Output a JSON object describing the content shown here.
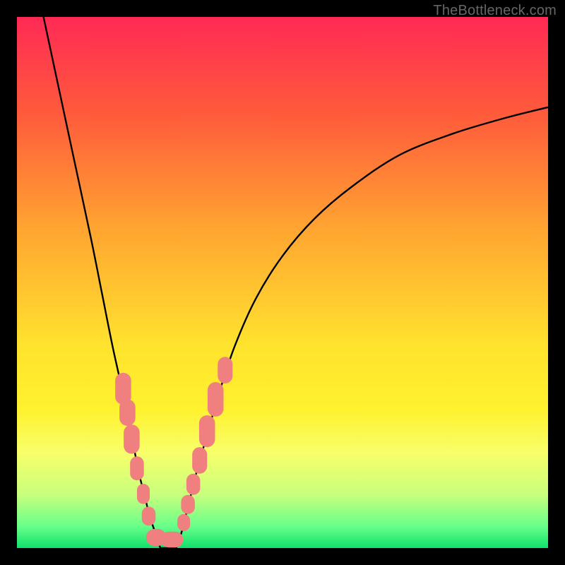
{
  "watermark": "TheBottleneck.com",
  "chart_data": {
    "type": "line",
    "title": "",
    "xlabel": "",
    "ylabel": "",
    "xlim": [
      0,
      100
    ],
    "ylim": [
      0,
      100
    ],
    "legend": null,
    "annotations": [],
    "background_gradient": {
      "stops": [
        {
          "offset": 0.0,
          "color": "#ff2a55"
        },
        {
          "offset": 0.18,
          "color": "#ff5a3c"
        },
        {
          "offset": 0.4,
          "color": "#ffa531"
        },
        {
          "offset": 0.62,
          "color": "#ffe32e"
        },
        {
          "offset": 0.74,
          "color": "#fff22f"
        },
        {
          "offset": 0.82,
          "color": "#f8ff6a"
        },
        {
          "offset": 0.9,
          "color": "#c8ff7d"
        },
        {
          "offset": 0.96,
          "color": "#66ff8a"
        },
        {
          "offset": 1.0,
          "color": "#10e06a"
        }
      ]
    },
    "series": [
      {
        "name": "left-curve",
        "stroke": "#000000",
        "x": [
          5,
          8,
          11,
          14,
          16,
          18,
          20,
          21,
          22,
          23,
          24,
          25,
          26,
          27
        ],
        "y": [
          100,
          86,
          72,
          58,
          48,
          38,
          29,
          24,
          19,
          14,
          10,
          6,
          3,
          0
        ]
      },
      {
        "name": "right-curve",
        "stroke": "#000000",
        "x": [
          30,
          31,
          32,
          33,
          34,
          36,
          38,
          41,
          45,
          50,
          56,
          63,
          72,
          82,
          92,
          100
        ],
        "y": [
          0,
          3,
          7,
          11,
          15,
          22,
          29,
          38,
          47,
          55,
          62,
          68,
          74,
          78,
          81,
          83
        ]
      },
      {
        "name": "floor",
        "stroke": "#000000",
        "x": [
          27,
          30
        ],
        "y": [
          0,
          0
        ]
      }
    ],
    "markers": {
      "color": "#f08080",
      "points": [
        {
          "x": 20.0,
          "y": 30.0,
          "w": 3.0,
          "h": 6.0
        },
        {
          "x": 20.8,
          "y": 25.5,
          "w": 3.0,
          "h": 5.0
        },
        {
          "x": 21.6,
          "y": 20.5,
          "w": 3.0,
          "h": 5.5
        },
        {
          "x": 22.6,
          "y": 15.0,
          "w": 2.6,
          "h": 4.5
        },
        {
          "x": 23.8,
          "y": 10.2,
          "w": 2.4,
          "h": 3.8
        },
        {
          "x": 24.8,
          "y": 6.0,
          "w": 2.6,
          "h": 3.6
        },
        {
          "x": 26.2,
          "y": 2.0,
          "w": 3.8,
          "h": 3.2
        },
        {
          "x": 29.2,
          "y": 1.6,
          "w": 4.2,
          "h": 3.0
        },
        {
          "x": 31.4,
          "y": 4.8,
          "w": 2.4,
          "h": 3.2
        },
        {
          "x": 32.2,
          "y": 8.2,
          "w": 2.6,
          "h": 3.6
        },
        {
          "x": 33.2,
          "y": 12.0,
          "w": 2.6,
          "h": 4.0
        },
        {
          "x": 34.4,
          "y": 16.5,
          "w": 2.8,
          "h": 5.0
        },
        {
          "x": 35.8,
          "y": 22.0,
          "w": 3.0,
          "h": 6.0
        },
        {
          "x": 37.4,
          "y": 28.0,
          "w": 3.0,
          "h": 6.5
        },
        {
          "x": 39.2,
          "y": 33.5,
          "w": 2.8,
          "h": 5.0
        }
      ]
    }
  }
}
